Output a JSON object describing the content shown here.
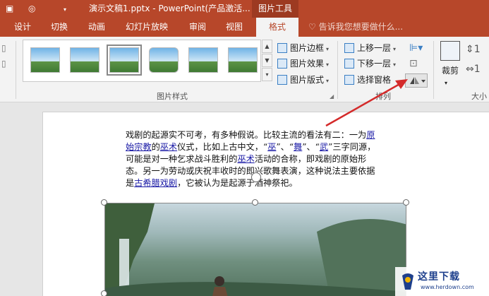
{
  "window": {
    "title": "演示文稿1.pptx - PowerPoint(产品激活...",
    "contextual_tab_group": "图片工具"
  },
  "tabs": [
    {
      "label": "设计"
    },
    {
      "label": "切换"
    },
    {
      "label": "动画"
    },
    {
      "label": "幻灯片放映"
    },
    {
      "label": "审阅"
    },
    {
      "label": "视图"
    },
    {
      "label": "格式",
      "active": true
    }
  ],
  "tell_me": "告诉我您想要做什么...",
  "ribbon": {
    "picture_styles": {
      "label": "图片样式",
      "buttons": {
        "border": "图片边框",
        "effects": "图片效果",
        "layout": "图片版式"
      }
    },
    "arrange": {
      "label": "排列",
      "bring_forward": "上移一层",
      "send_backward": "下移一层",
      "selection_pane": "选择窗格"
    },
    "crop": "裁剪",
    "size_label": "大小"
  },
  "document": {
    "paragraph_parts": [
      {
        "text": "戏剧的起源实不可考，有多种假说。比较主流的看法有二：一为"
      },
      {
        "text": "原始宗教",
        "link": true
      },
      {
        "text": "的"
      },
      {
        "text": "巫术",
        "link": true
      },
      {
        "text": "仪式，比如上古中文，“"
      },
      {
        "text": "巫",
        "link": true
      },
      {
        "text": "”、“"
      },
      {
        "text": "舞",
        "link": true
      },
      {
        "text": "”、“"
      },
      {
        "text": "武",
        "link": true
      },
      {
        "text": "”三字同源，可能是对一种乞求战斗胜利的"
      },
      {
        "text": "巫术",
        "link": true
      },
      {
        "text": "活动的合称，即戏剧的原始形态。另一为劳动或庆祝丰收时的即兴歌舞表演，这种说法主要依据是"
      },
      {
        "text": "古希腊戏剧",
        "link": true
      },
      {
        "text": "，它被认为是起源于酒神祭祀。"
      }
    ]
  },
  "watermark": {
    "main": "这里下载",
    "sub": "www.herdown.com"
  },
  "colors": {
    "accent": "#b7472a",
    "annotation_arrow": "#d42a2a",
    "link": "#1a1aa6"
  }
}
